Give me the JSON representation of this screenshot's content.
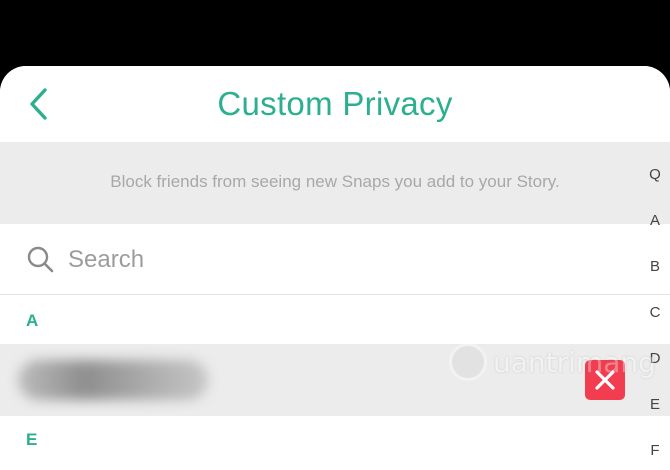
{
  "header": {
    "title": "Custom Privacy",
    "back_icon": "chevron-left-icon"
  },
  "info": {
    "text": "Block friends from seeing new Snaps you add to your Story."
  },
  "search": {
    "placeholder": "Search",
    "value": "",
    "icon": "search-icon"
  },
  "sections": [
    {
      "letter": "A",
      "friends": [
        {
          "name_blurred": true,
          "remove_icon": "close-icon"
        }
      ]
    },
    {
      "letter": "E",
      "friends": []
    }
  ],
  "index_letters": [
    "Q",
    "A",
    "B",
    "C",
    "D",
    "E",
    "F"
  ],
  "watermark": {
    "text": "uantrimang"
  },
  "colors": {
    "accent": "#2baf8e",
    "remove": "#f23c4f",
    "band": "#ececec",
    "info_text": "#a8a8a8"
  }
}
